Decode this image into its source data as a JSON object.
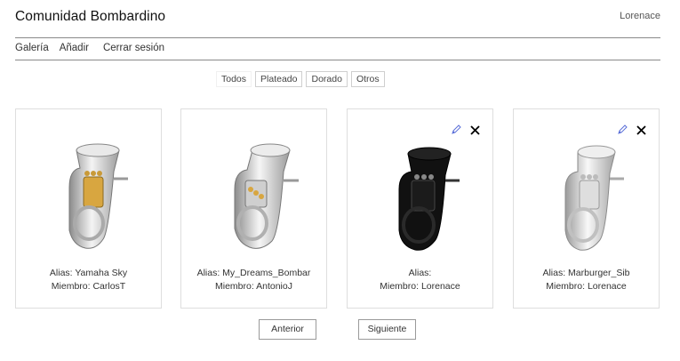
{
  "header": {
    "title": "Comunidad Bombardino",
    "user": "Lorenace"
  },
  "nav": {
    "items": [
      "Galería",
      "Añadir",
      "Cerrar sesión"
    ]
  },
  "filters": {
    "items": [
      "Todos",
      "Plateado",
      "Dorado",
      "Otros"
    ],
    "selected": "Todos"
  },
  "cards": [
    {
      "alias": "Alias: Yamaha Sky",
      "member": "Miembro: CarlosT",
      "finish": "silver-gold",
      "can_edit": false
    },
    {
      "alias": "Alias: My_Dreams_Bombar",
      "member": "Miembro: AntonioJ",
      "finish": "silver-gold",
      "can_edit": false
    },
    {
      "alias": "Alias:",
      "member": "Miembro: Lorenace",
      "finish": "black",
      "can_edit": true
    },
    {
      "alias": "Alias: Marburger_Sib",
      "member": "Miembro: Lorenace",
      "finish": "silver",
      "can_edit": true
    }
  ],
  "pager": {
    "prev_label": "Anterior",
    "next_label": "Siguiente"
  },
  "colors": {
    "rule": "#8a8a8a",
    "card_border": "#dedede",
    "edit_icon": "#5a6fd8",
    "close_icon": "#000000"
  }
}
